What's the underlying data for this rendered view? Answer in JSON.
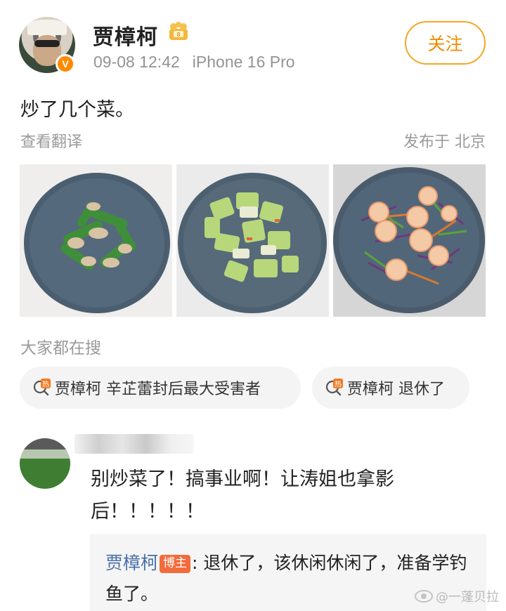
{
  "post": {
    "author": "贾樟柯",
    "time": "09-08 12:42",
    "device": "iPhone 16 Pro",
    "follow_label": "关注",
    "verified_badge": "V",
    "text": "炒了几个菜。",
    "translate_label": "查看翻译",
    "location": "发布于 北京",
    "images": [
      {
        "icon": "dish-snow-peas-pork"
      },
      {
        "icon": "dish-stir-fried-squash"
      },
      {
        "icon": "dish-shrimp-salad"
      }
    ]
  },
  "search": {
    "title": "大家都在搜",
    "hot_icon_text": "热",
    "chips": [
      {
        "label": "贾樟柯 辛芷蕾封后最大受害者"
      },
      {
        "label": "贾樟柯 退休了"
      }
    ]
  },
  "comment": {
    "text": "别炒菜了！搞事业啊！让涛姐也拿影后！！！！！",
    "reply": {
      "author": "贾樟柯",
      "tag": "博主",
      "colon": ":",
      "text": " 退休了，该休闲休闲了，准备学钓鱼了。"
    }
  },
  "watermark": "@一蓬贝拉",
  "colors": {
    "accent": "#f5a623",
    "link": "#486fa8",
    "owner_tag": "#f26b3a",
    "muted": "#9a9a9a"
  }
}
